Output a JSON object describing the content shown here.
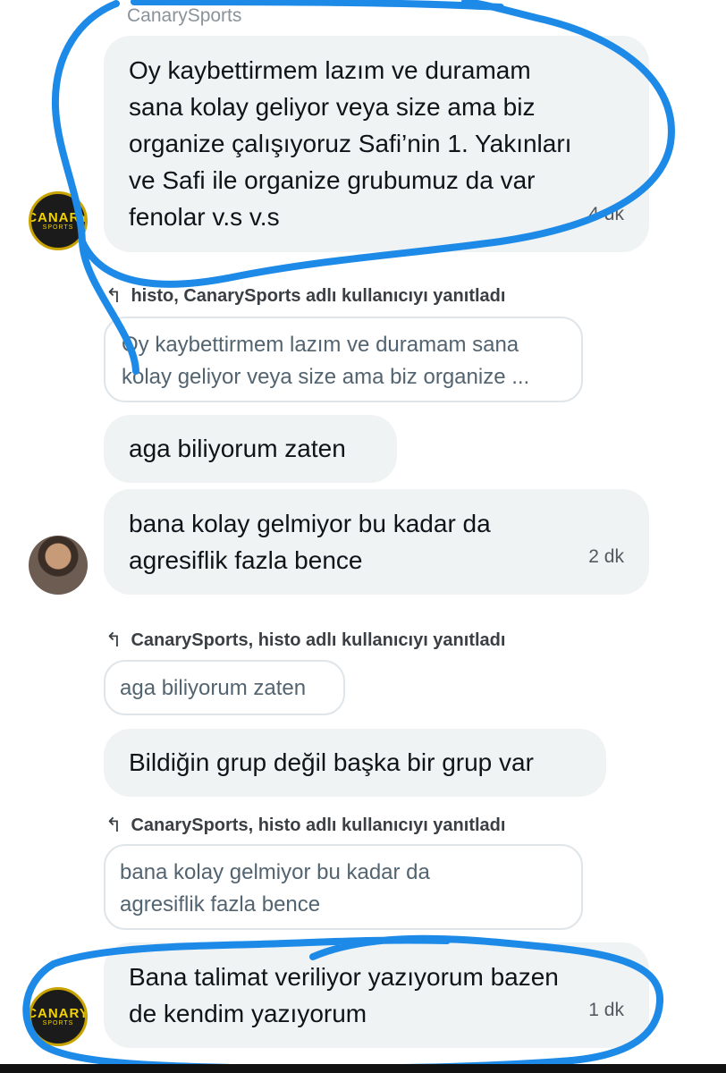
{
  "messages": {
    "m1": {
      "sender": "CanarySports",
      "text": "Oy kaybettirmem lazım ve duramam\nsana kolay geliyor veya size ama biz\norganize çalışıyoruz Safi’nin 1. Yakınları\nve Safi ile organize grubumuz da var\nfenolar v.s v.s",
      "time": "4 dk"
    },
    "m2": {
      "reply_header": "histo, CanarySports adlı kullanıcıyı yanıtladı",
      "quote": "Oy kaybettirmem lazım ve duramam sana\nkolay geliyor veya size ama biz organize ...",
      "text": "aga biliyorum zaten"
    },
    "m3": {
      "text": "bana kolay gelmiyor bu kadar da\nagresiflik fazla bence",
      "time": "2 dk"
    },
    "m4": {
      "reply_header": "CanarySports, histo adlı kullanıcıyı yanıtladı",
      "quote": "aga biliyorum zaten",
      "text": "Bildiğin grup değil başka bir grup var"
    },
    "m5": {
      "reply_header": "CanarySports, histo adlı kullanıcıyı yanıtladı",
      "quote": "bana kolay gelmiyor bu kadar da\nagresiflik fazla bence",
      "text": "Bana talimat veriliyor yazıyorum bazen\nde kendim yazıyorum",
      "time": "1 dk"
    }
  },
  "avatars": {
    "canary_line1": "CANARY",
    "canary_line2": "SPORTS"
  },
  "colors": {
    "bubble": "#eff3f4",
    "annotation": "#1d8ae8"
  },
  "icons": {
    "reply": "reply-arrow-icon"
  }
}
